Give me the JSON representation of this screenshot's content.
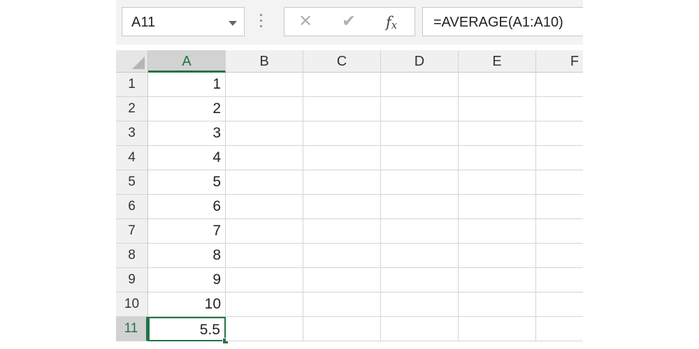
{
  "formula_bar": {
    "name_box": "A11",
    "cancel_icon": "✕",
    "enter_icon": "✔",
    "function_icon": "fx",
    "formula": "=AVERAGE(A1:A10)"
  },
  "grid": {
    "columns": [
      "A",
      "B",
      "C",
      "D",
      "E",
      "F"
    ],
    "selected_column": "A",
    "rows": [
      "1",
      "2",
      "3",
      "4",
      "5",
      "6",
      "7",
      "8",
      "9",
      "10",
      "11"
    ],
    "selected_row": "11",
    "active_cell": "A11",
    "column_a": [
      "1",
      "2",
      "3",
      "4",
      "5",
      "6",
      "7",
      "8",
      "9",
      "10",
      "5.5"
    ]
  },
  "colors": {
    "selection_accent": "#217346",
    "header_bg": "#f0f0f0",
    "gridline": "#d4d4d4"
  }
}
